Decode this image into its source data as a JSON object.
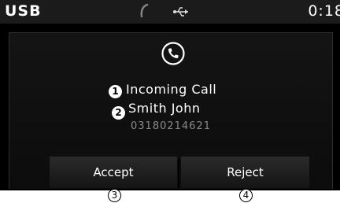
{
  "status_bar": {
    "source": "USB",
    "clock": "0:18",
    "icons": [
      "phone-icon",
      "usb-icon"
    ]
  },
  "call": {
    "icon": "phone-call-icon",
    "title": "Incoming Call",
    "caller_name": "Smith John",
    "caller_number": "03180214621"
  },
  "buttons": {
    "accept": "Accept",
    "reject": "Reject"
  },
  "callouts": {
    "marker1": "1",
    "marker2": "2",
    "marker3": "3",
    "marker4": "4"
  }
}
